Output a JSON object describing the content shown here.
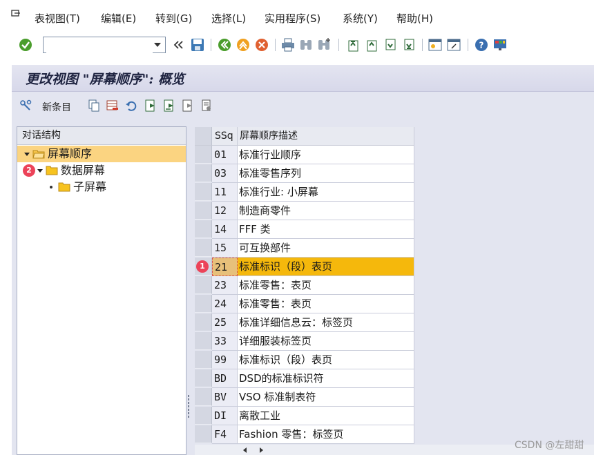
{
  "menu": {
    "items": [
      "表视图(T)",
      "编辑(E)",
      "转到(G)",
      "选择(L)",
      "实用程序(S)",
      "系统(Y)",
      "帮助(H)"
    ]
  },
  "toolbar": {
    "command_value": "",
    "icons": [
      "enter-icon",
      "back-double-icon",
      "save-icon",
      "back-icon",
      "exit-icon",
      "cancel-icon",
      "print-icon",
      "find-icon",
      "find-next-icon",
      "first-page-icon",
      "prev-page-icon",
      "next-page-icon",
      "last-page-icon",
      "new-session-icon",
      "shortcut-icon",
      "help-icon",
      "layout-icon"
    ]
  },
  "title": "更改视图 \"屏幕顺序\": 概览",
  "app_toolbar": {
    "new_entries_label": "新条目"
  },
  "tree": {
    "header": "对话结构",
    "nodes": [
      {
        "label": "屏幕顺序",
        "selected": true
      },
      {
        "label": "数据屏幕",
        "badge": "2"
      },
      {
        "label": "子屏幕"
      }
    ]
  },
  "table": {
    "headers": {
      "key": "SSq",
      "desc": "屏幕顺序描述"
    },
    "highlight_badge": "1",
    "rows": [
      {
        "key": "01",
        "desc": "标准行业顺序"
      },
      {
        "key": "03",
        "desc": "标准零售序列"
      },
      {
        "key": "11",
        "desc": "标准行业: 小屏幕"
      },
      {
        "key": "12",
        "desc": "制造商零件"
      },
      {
        "key": "14",
        "desc": "FFF 类"
      },
      {
        "key": "15",
        "desc": "可互换部件"
      },
      {
        "key": "21",
        "desc": "标准标识（段）表页",
        "highlight": true
      },
      {
        "key": "23",
        "desc": "标准零售：表页"
      },
      {
        "key": "24",
        "desc": "标准零售：表页"
      },
      {
        "key": "25",
        "desc": "标准详细信息云：标签页"
      },
      {
        "key": "33",
        "desc": "详细服装标签页"
      },
      {
        "key": "99",
        "desc": "标准标识（段）表页"
      },
      {
        "key": "BD",
        "desc": "DSD的标准标识符"
      },
      {
        "key": "BV",
        "desc": "VSO 标准制表符"
      },
      {
        "key": "DI",
        "desc": "离散工业"
      },
      {
        "key": "F4",
        "desc": "Fashion 零售：标签页"
      }
    ]
  },
  "watermark": "CSDN @左甜甜",
  "colors": {
    "selection": "#fbd481",
    "highlight_row": "#f5b80c",
    "title_bg": "#d7d8ea",
    "badge": "#ec4359"
  }
}
